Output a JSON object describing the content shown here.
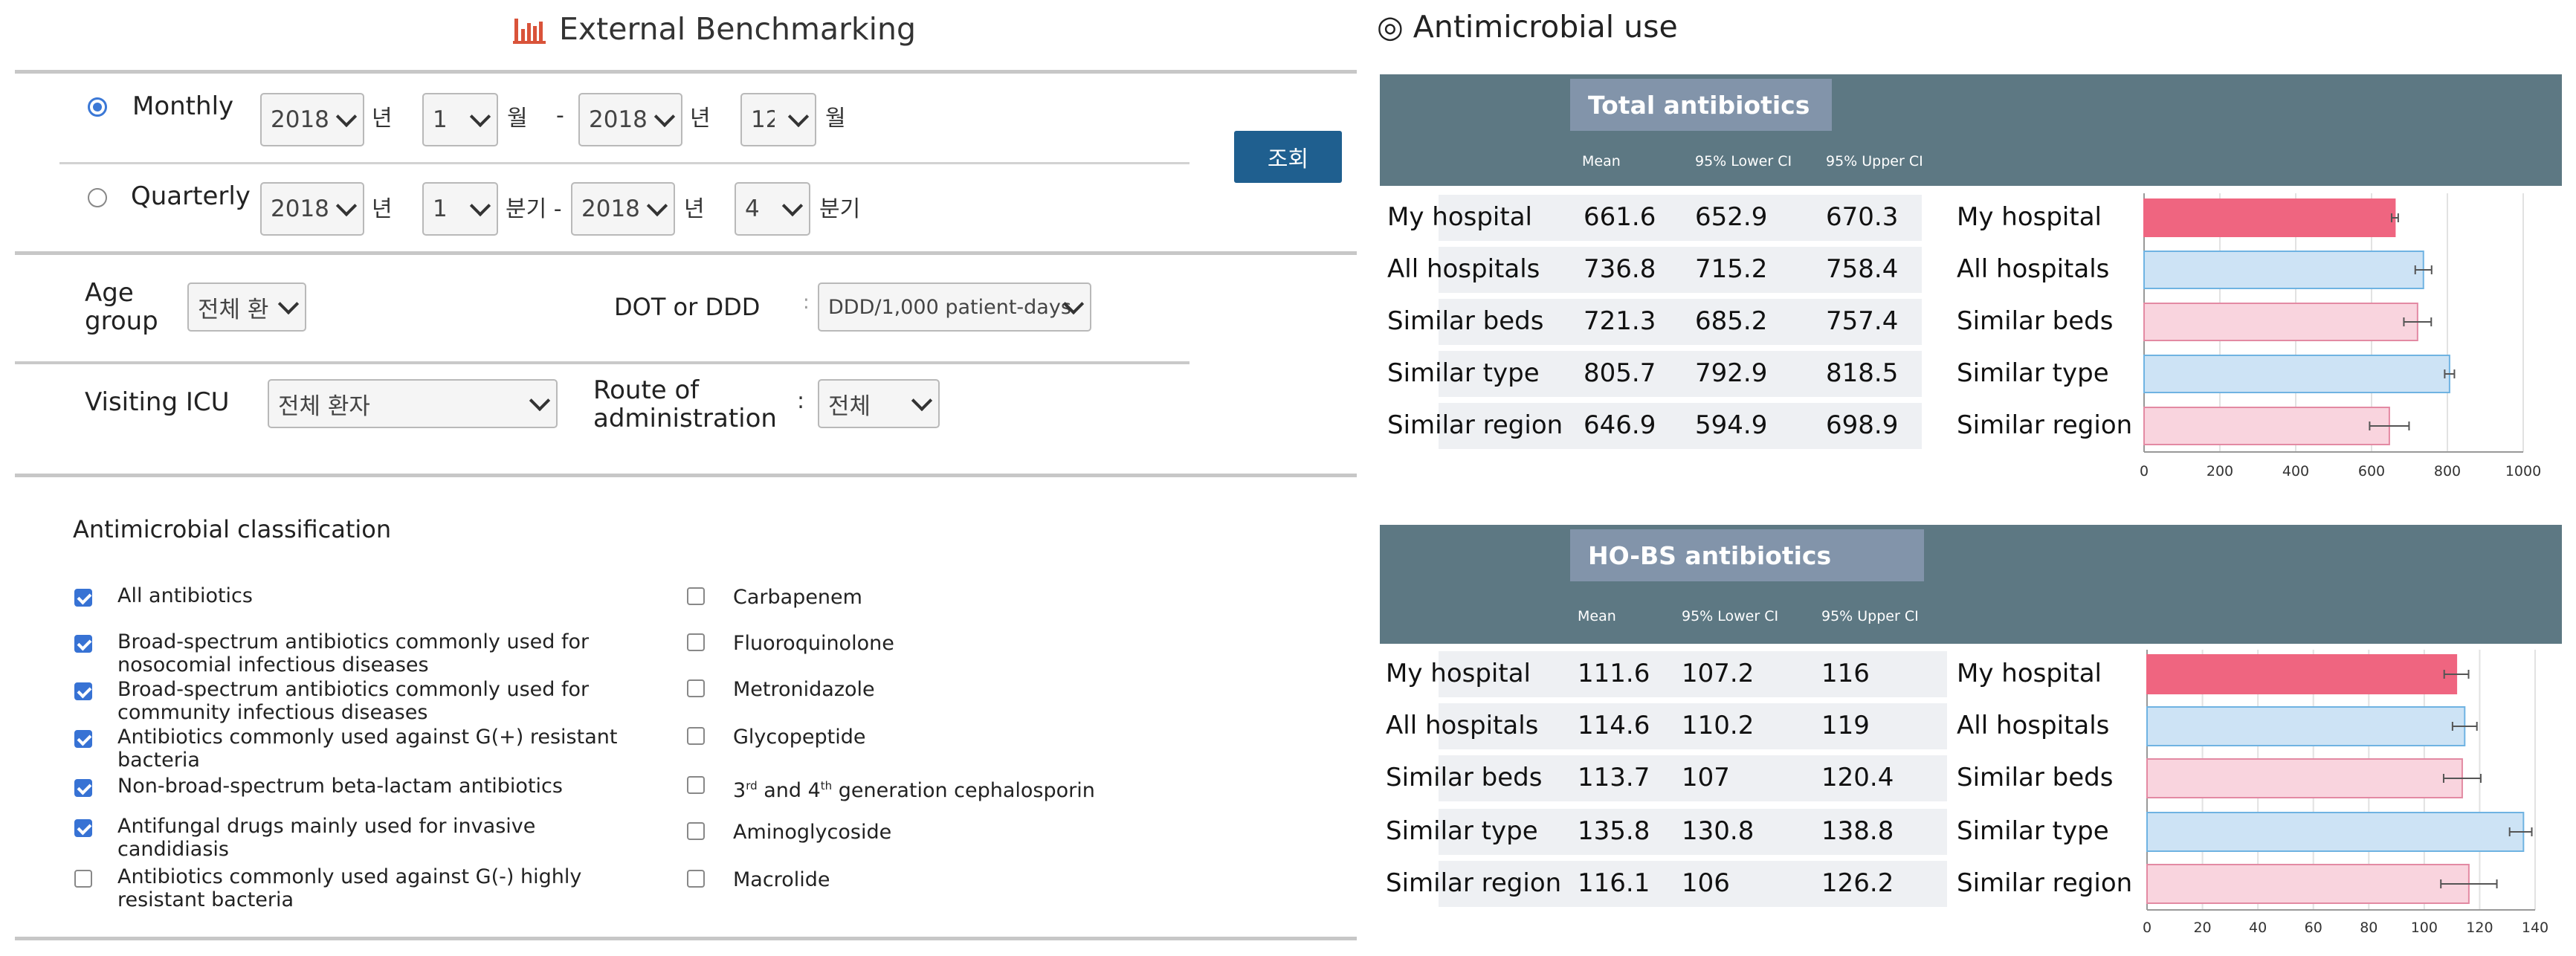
{
  "left_title": "External Benchmarking",
  "right_title": "◎ Antimicrobial use",
  "period": {
    "monthly_label": "Monthly",
    "quarterly_label": "Quarterly",
    "monthly_from_year": "2018",
    "monthly_from_month": "1",
    "monthly_to_year": "2018",
    "monthly_to_month": "12",
    "quarterly_from_year": "2018",
    "quarterly_from_q": "1",
    "quarterly_to_year": "2018",
    "quarterly_to_q": "4",
    "unit_year": "년",
    "unit_month": "월",
    "unit_quarter": "분기",
    "unit_quarter_dash": "분기 -",
    "dash": "-",
    "selected": "monthly"
  },
  "search_button": "조회",
  "filters": {
    "age_label_1": "Age",
    "age_label_2": "group",
    "age_value": "전체 환",
    "dot_label": "DOT  or  DDD",
    "dot_colon": ":",
    "dot_value": "DDD/1,000 patient-days",
    "icu_label": "Visiting  ICU",
    "icu_value": "전체 환자",
    "route_label_1": "Route of",
    "route_label_2": "administration",
    "route_colon": ":",
    "route_value": "전체"
  },
  "classification": {
    "title": "Antimicrobial  classification",
    "left": [
      {
        "l1": "All antibiotics",
        "l2": "",
        "checked": true
      },
      {
        "l1": "Broad-spectrum antibiotics commonly used for",
        "l2": "nosocomial infectious diseases",
        "checked": true
      },
      {
        "l1": "Broad-spectrum antibiotics commonly used for",
        "l2": "community infectious diseases",
        "checked": true
      },
      {
        "l1": "Antibiotics commonly used against G(+) resistant",
        "l2": "bacteria",
        "checked": true
      },
      {
        "l1": "Non-broad-spectrum beta-lactam antibiotics",
        "l2": "",
        "checked": true
      },
      {
        "l1": "Antifungal drugs mainly used for invasive",
        "l2": "candidiasis",
        "checked": true
      },
      {
        "l1": "Antibiotics commonly used against G(-) highly",
        "l2": "resistant bacteria",
        "checked": false
      }
    ],
    "right": [
      {
        "label": "Carbapenem",
        "checked": false
      },
      {
        "label": "Fluoroquinolone",
        "checked": false
      },
      {
        "label": "Metronidazole",
        "checked": false
      },
      {
        "label": "Glycopeptide",
        "checked": false
      },
      {
        "label_pre": "3",
        "label_sup1": "rd",
        "label_mid": " and 4",
        "label_sup2": "th",
        "label_post": "  generation cephalosporin",
        "checked": false
      },
      {
        "label": "Aminoglycoside",
        "checked": false
      },
      {
        "label": "Macrolide",
        "checked": false
      }
    ]
  },
  "chart_data": [
    {
      "type": "bar",
      "title": "Total antibiotics",
      "columns": [
        "Mean",
        "95% Lower CI",
        "95% Upper CI"
      ],
      "categories": [
        "My hospital",
        "All hospitals",
        "Similar beds",
        "Similar type",
        "Similar region"
      ],
      "series": [
        {
          "name": "Mean",
          "values": [
            661.6,
            736.8,
            721.3,
            805.7,
            646.9
          ]
        },
        {
          "name": "95% Lower CI",
          "values": [
            652.9,
            715.2,
            685.2,
            792.9,
            594.9
          ]
        },
        {
          "name": "95% Upper CI",
          "values": [
            670.3,
            758.4,
            757.4,
            818.5,
            698.9
          ]
        }
      ],
      "display": [
        [
          "661.6",
          "652.9",
          "670.3"
        ],
        [
          "736.8",
          "715.2",
          "758.4"
        ],
        [
          "721.3",
          "685.2",
          "757.4"
        ],
        [
          "805.7",
          "792.9",
          "818.5"
        ],
        [
          "646.9",
          "594.9",
          "698.9"
        ]
      ],
      "xlim": [
        0,
        1000
      ],
      "ticks": [
        0,
        200,
        400,
        600,
        800,
        1000
      ],
      "grid": true
    },
    {
      "type": "bar",
      "title": "HO-BS antibiotics",
      "columns": [
        "Mean",
        "95% Lower CI",
        "95% Upper CI"
      ],
      "categories": [
        "My hospital",
        "All hospitals",
        "Similar beds",
        "Similar type",
        "Similar region"
      ],
      "series": [
        {
          "name": "Mean",
          "values": [
            111.6,
            114.6,
            113.7,
            135.8,
            116.1
          ]
        },
        {
          "name": "95% Lower CI",
          "values": [
            107.2,
            110.2,
            107,
            130.8,
            106
          ]
        },
        {
          "name": "95% Upper CI",
          "values": [
            116,
            119,
            120.4,
            138.8,
            126.2
          ]
        }
      ],
      "display": [
        [
          "111.6",
          "107.2",
          "116"
        ],
        [
          "114.6",
          "110.2",
          "119"
        ],
        [
          "113.7",
          "107",
          "120.4"
        ],
        [
          "135.8",
          "130.8",
          "138.8"
        ],
        [
          "116.1",
          "106",
          "126.2"
        ]
      ],
      "xlim": [
        0,
        140
      ],
      "ticks": [
        0,
        20,
        40,
        60,
        80,
        100,
        120,
        140
      ],
      "grid": true
    }
  ],
  "colors": {
    "my_hospital_fill": "#ef6580",
    "blue_fill": "#cde3f5",
    "blue_stroke": "#6fb3e2",
    "pink_fill": "#f9d4de",
    "pink_stroke": "#e38aa3"
  }
}
